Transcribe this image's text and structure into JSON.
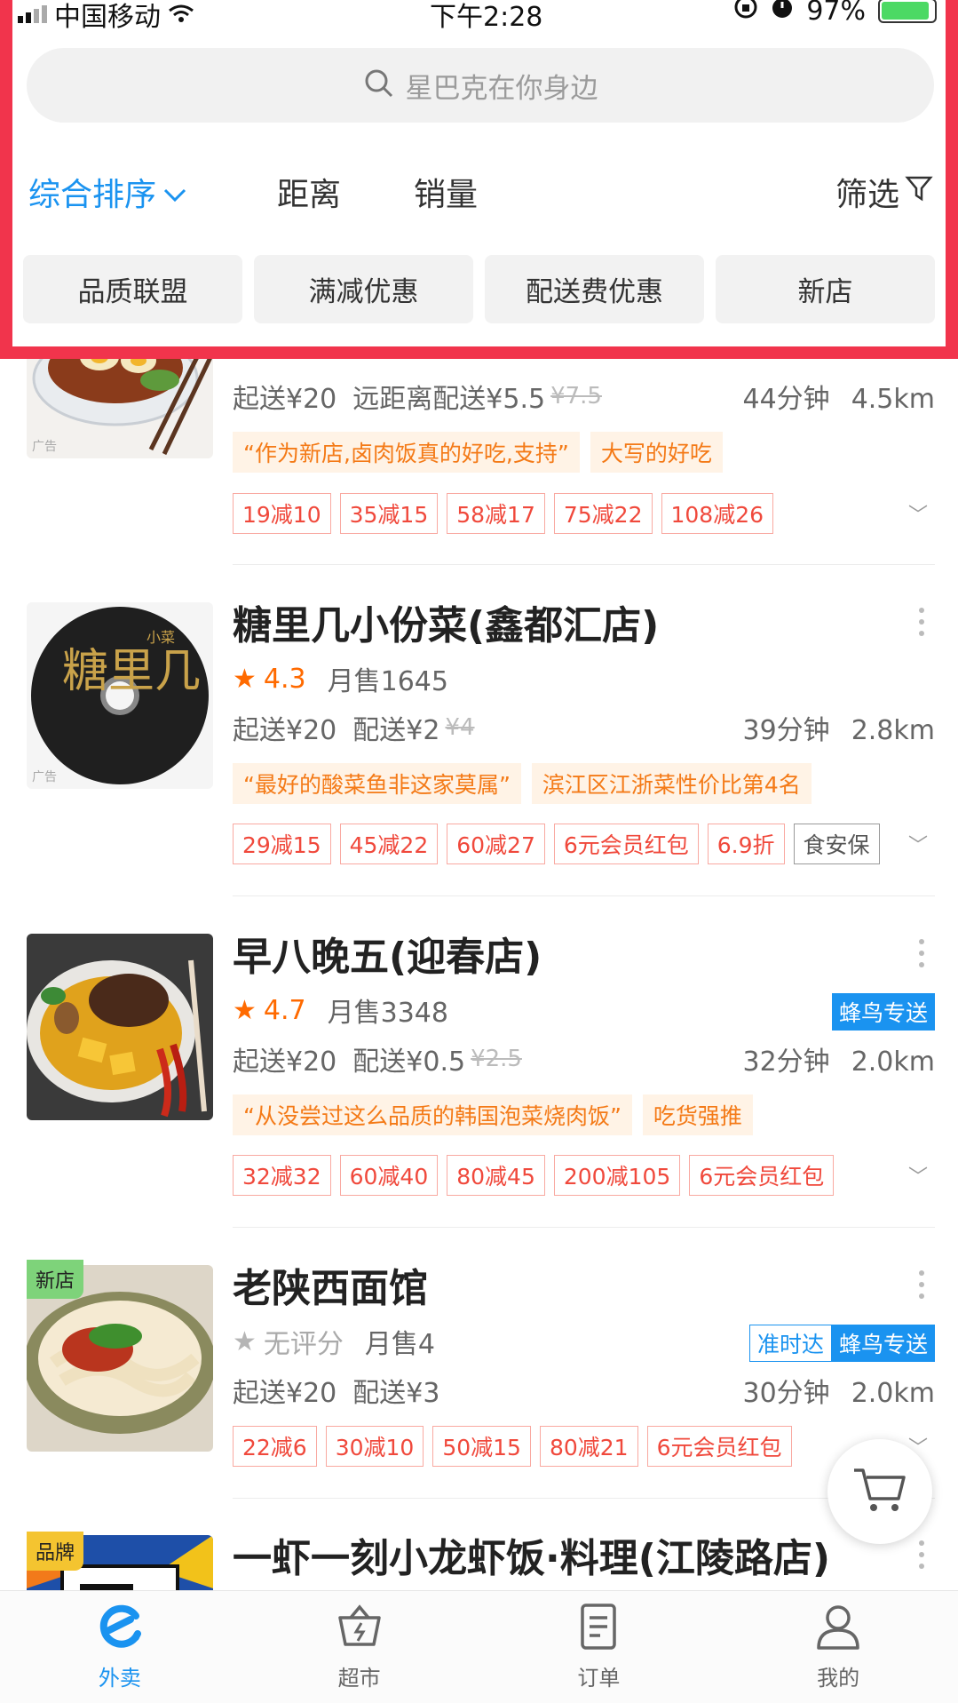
{
  "status_bar": {
    "carrier": "中国移动",
    "time": "下午2:28",
    "battery": "97%"
  },
  "search": {
    "placeholder": "星巴克在你身边"
  },
  "sort_bar": {
    "main": "综合排序",
    "distance": "距离",
    "sales": "销量",
    "filter": "筛选"
  },
  "chips": [
    "品质联盟",
    "满减优惠",
    "配送费优惠",
    "新店"
  ],
  "shops": [
    {
      "name": "",
      "min_order": "起送¥20",
      "delivery_fee": "远距离配送¥5.5",
      "orig_fee": "¥7.5",
      "time": "44分钟",
      "distance": "4.5km",
      "ad_label": "广告",
      "quotes": [
        "“作为新店,卤肉饭真的好吃,支持”",
        "大写的好吃"
      ],
      "promos": [
        "19减10",
        "35减15",
        "58减17",
        "75减22",
        "108减26"
      ]
    },
    {
      "name": "糖里几小份菜(鑫都汇店)",
      "rating": "4.3",
      "monthly_sales": "月售1645",
      "min_order": "起送¥20",
      "delivery_fee": "配送¥2",
      "orig_fee": "¥4",
      "time": "39分钟",
      "distance": "2.8km",
      "ad_label": "广告",
      "logo_text": "糖里几",
      "logo_small": "小菜",
      "quotes": [
        "“最好的酸菜鱼非这家莫属”",
        "滨江区江浙菜性价比第4名"
      ],
      "promos": [
        "29减15",
        "45减22",
        "60减27",
        "6元会员红包",
        "6.9折",
        "食安保"
      ]
    },
    {
      "name": "早八晚五(迎春店)",
      "rating": "4.7",
      "monthly_sales": "月售3348",
      "badge": "蜂鸟专送",
      "min_order": "起送¥20",
      "delivery_fee": "配送¥0.5",
      "orig_fee": "¥2.5",
      "time": "32分钟",
      "distance": "2.0km",
      "quotes": [
        "“从没尝过这么品质的韩国泡菜烧肉饭”",
        "吃货强推"
      ],
      "promos": [
        "32减32",
        "60减40",
        "80减45",
        "200减105",
        "6元会员红包"
      ]
    },
    {
      "name": "老陕西面馆",
      "rating": "无评分",
      "monthly_sales": "月售4",
      "tag": "新店",
      "badge_on_time": "准时达",
      "badge": "蜂鸟专送",
      "min_order": "起送¥20",
      "delivery_fee": "配送¥3",
      "time": "30分钟",
      "distance": "2.0km",
      "promos": [
        "22减6",
        "30减10",
        "50减15",
        "80减21",
        "6元会员红包"
      ]
    },
    {
      "name": "一虾一刻小龙虾饭·料理(江陵路店)",
      "tag": "品牌"
    }
  ],
  "tabbar": [
    "外卖",
    "超市",
    "订单",
    "我的"
  ],
  "colors": {
    "accent": "#1a93f0",
    "highlight": "#f1344c",
    "rating": "#ff6a00",
    "promo": "#f0493c"
  }
}
